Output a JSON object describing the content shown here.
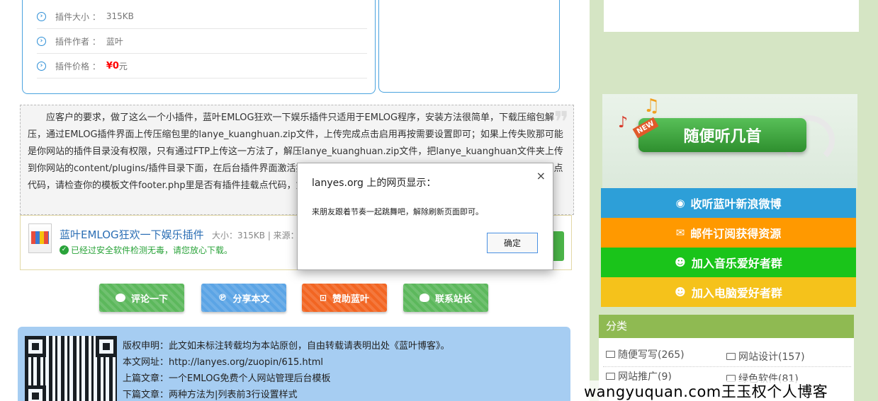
{
  "info": {
    "rows": [
      {
        "label": "插件大小 ：",
        "value": "315KB"
      },
      {
        "label": "插件作者 ：",
        "value": "蓝叶"
      },
      {
        "label": "插件价格 ：",
        "price_symbol": "¥",
        "price_num": "0",
        "price_unit": "元"
      }
    ]
  },
  "description": "应客户的要求，做了这么一个小插件，蓝叶EMLOG狂欢一下娱乐插件只适用于EMLOG程序，安装方法很简单，下载压缩包解压，通过EMLOG插件界面上传压缩包里的lanye_kuanghuan.zip文件，上传完成点击启用再按需要设置即可；如果上传失败那可能是你网站的插件目录没有权限，只有通过FTP上传这一方法了，解压lanye_kuanghuan.zip文件，把lanye_kuanghuan文件夹上传到你网站的content/plugins/插件目录下面，在后台插件界面激活按照下面设置即可。如果没有效果可能是你的模板没有插件挂载点代码，请检查你的模板文件footer.php里是否有插件挂载点代码，如没有请自行添加插件挂载点，如没有请自行添加。",
  "download": {
    "title": "蓝叶EMLOG狂欢一下娱乐插件",
    "meta": "大小：315KB | 来源：蓝",
    "safe_text": "已经过安全软件检测无毒，请您放心下载。"
  },
  "actions": [
    {
      "label": "评论一下",
      "color": "#5cb85c"
    },
    {
      "label": "分享本文",
      "color": "#5ba4e5"
    },
    {
      "label": "赞助蓝叶",
      "color": "#f26522"
    },
    {
      "label": "联系站长",
      "color": "#5cb85c"
    }
  ],
  "copyright": {
    "line1": "版权申明：此文如未标注转载均为本站原创，自由转载请表明出处《蓝叶博客》。",
    "line2": "本文网址：http://lanyes.org/zuopin/615.html",
    "line3": "上篇文章：一个EMLOG免费个人网站管理后台模板",
    "line4": "下篇文章：两种方法为|列表前3行设置样式"
  },
  "sidebar": {
    "music_title": "随便听几首",
    "music_new": "NEW",
    "buttons": [
      {
        "label": "收听蓝叶新浪微博",
        "icon": "weibo-icon",
        "color": "#2d9fd8"
      },
      {
        "label": "邮件订阅获得资源",
        "icon": "mail-icon",
        "color": "#ff9900"
      },
      {
        "label": "加入音乐爱好者群",
        "icon": "qq-icon",
        "color": "#1ac41a"
      },
      {
        "label": "加入电脑爱好者群",
        "icon": "qq-icon",
        "color": "#f5c21b"
      }
    ],
    "category_title": "分类",
    "categories": [
      {
        "label": "随便写写(265)"
      },
      {
        "label": "网站设计(157)"
      },
      {
        "label": "网站推广(9)"
      },
      {
        "label": "绿色软件(81)"
      }
    ]
  },
  "watermark": "wangyuquan.com王玉权个人博客",
  "dialog": {
    "title": "lanyes.org 上的网页显示：",
    "message": "来朋友跟着节奏一起跳舞吧，解除刷新页面即可。",
    "ok_label": "确定",
    "close_glyph": "×"
  }
}
